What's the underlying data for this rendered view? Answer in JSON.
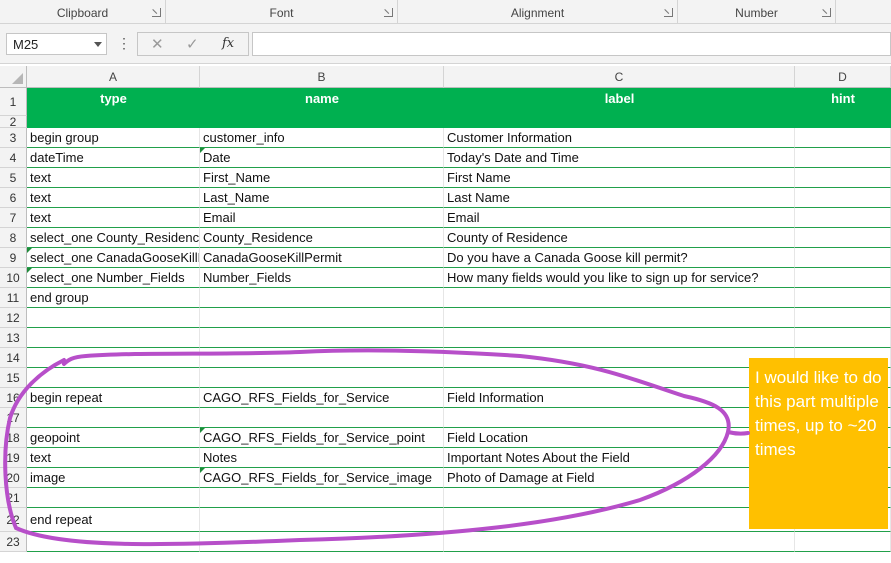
{
  "ribbon": {
    "groups": [
      {
        "label": "Clipboard"
      },
      {
        "label": "Font"
      },
      {
        "label": "Alignment"
      },
      {
        "label": "Number"
      }
    ]
  },
  "formula_bar": {
    "name_box": "M25",
    "cancel_icon": "close-icon",
    "enter_icon": "checkmark-icon",
    "function_label": "fx",
    "formula_value": ""
  },
  "columns": [
    "A",
    "B",
    "C",
    "D"
  ],
  "sheet": {
    "headers": {
      "type": "type",
      "name": "name",
      "label": "label",
      "hint": "hint"
    },
    "rows": [
      {
        "num": "1",
        "type": "",
        "name": "",
        "label": ""
      },
      {
        "num": "2",
        "type": "",
        "name": "",
        "label": ""
      },
      {
        "num": "3",
        "type": "begin group",
        "name": "customer_info",
        "label": "Customer Information"
      },
      {
        "num": "4",
        "type": "dateTime",
        "name": "Date",
        "label": "Today's Date and Time"
      },
      {
        "num": "5",
        "type": "text",
        "name": "First_Name",
        "label": "First Name"
      },
      {
        "num": "6",
        "type": "text",
        "name": "Last_Name",
        "label": "Last Name"
      },
      {
        "num": "7",
        "type": "text",
        "name": "Email",
        "label": "Email"
      },
      {
        "num": "8",
        "type": "select_one County_Residence",
        "name": "County_Residence",
        "label": "County of Residence"
      },
      {
        "num": "9",
        "type": "select_one CanadaGooseKillPermit",
        "name": "CanadaGooseKillPermit",
        "label": "Do you have a Canada Goose kill permit?"
      },
      {
        "num": "10",
        "type": "select_one Number_Fields",
        "name": "Number_Fields",
        "label": "How many fields would you like to sign up for service?"
      },
      {
        "num": "11",
        "type": "end group",
        "name": "",
        "label": ""
      },
      {
        "num": "12",
        "type": "",
        "name": "",
        "label": ""
      },
      {
        "num": "13",
        "type": "",
        "name": "",
        "label": ""
      },
      {
        "num": "14",
        "type": "",
        "name": "",
        "label": ""
      },
      {
        "num": "15",
        "type": "",
        "name": "",
        "label": ""
      },
      {
        "num": "16",
        "type": "begin repeat",
        "name": "CAGO_RFS_Fields_for_Service",
        "label": "Field Information"
      },
      {
        "num": "17",
        "type": "",
        "name": "",
        "label": ""
      },
      {
        "num": "18",
        "type": "geopoint",
        "name": "CAGO_RFS_Fields_for_Service_point",
        "label": "Field Location"
      },
      {
        "num": "19",
        "type": "text",
        "name": "Notes",
        "label": "Important Notes About the Field"
      },
      {
        "num": "20",
        "type": "image",
        "name": "CAGO_RFS_Fields_for_Service_image",
        "label": "Photo of Damage at Field"
      },
      {
        "num": "21",
        "type": "",
        "name": "",
        "label": ""
      },
      {
        "num": "22",
        "type": "end repeat",
        "name": "",
        "label": ""
      },
      {
        "num": "23",
        "type": "",
        "name": "",
        "label": ""
      }
    ]
  },
  "annotation": {
    "note_text": "I would like to do this part multiple times, up to ~20 times",
    "note_color": "#ffc000",
    "loop_color": "#b74fc9"
  },
  "colors": {
    "header_green": "#00b050",
    "gridline_green": "#21a04a"
  }
}
